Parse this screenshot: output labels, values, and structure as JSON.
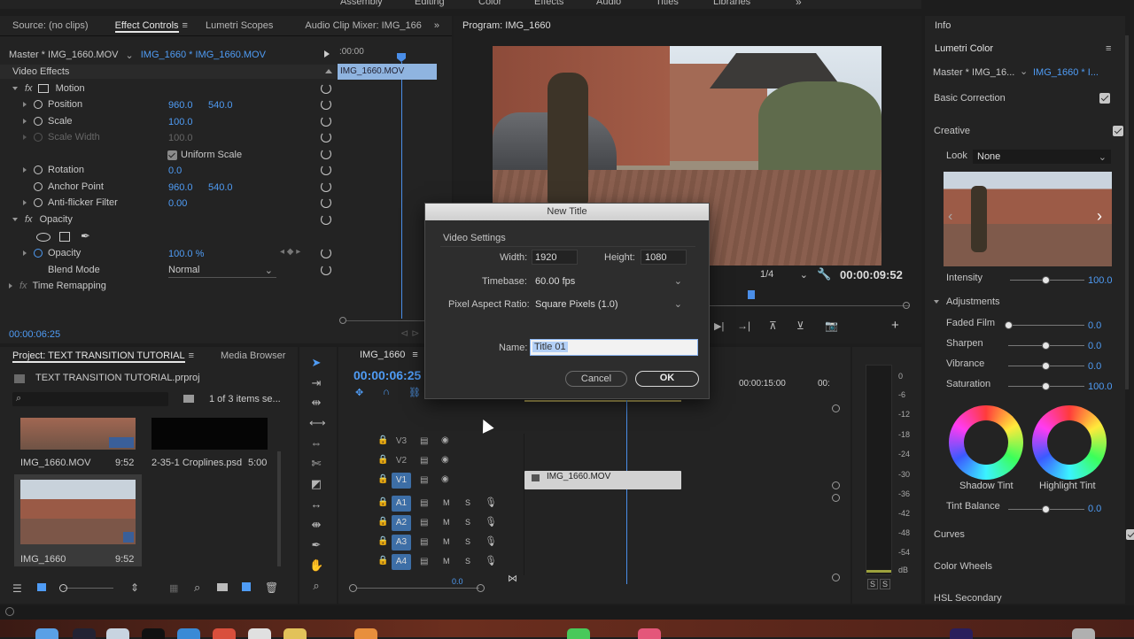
{
  "menu": {
    "items": [
      "Assembly",
      "Editing",
      "Color",
      "Effects",
      "Audio",
      "Titles",
      "Libraries"
    ],
    "more": "»"
  },
  "source_panel": {
    "tabs": [
      "Source: (no clips)",
      "Effect Controls",
      "Lumetri Scopes",
      "Audio Clip Mixer: IMG_166"
    ],
    "master_label": "Master * IMG_1660.MOV",
    "clip_label": "IMG_1660 * IMG_1660.MOV",
    "section": "Video Effects",
    "ruler_time": ":00:00",
    "clip_bar": "IMG_1660.MOV",
    "motion": "Motion",
    "position": {
      "label": "Position",
      "x": "960.0",
      "y": "540.0"
    },
    "scale": {
      "label": "Scale",
      "value": "100.0"
    },
    "scale_width": {
      "label": "Scale Width",
      "value": "100.0"
    },
    "uniform_scale": "Uniform Scale",
    "rotation": {
      "label": "Rotation",
      "value": "0.0"
    },
    "anchor": {
      "label": "Anchor Point",
      "x": "960.0",
      "y": "540.0"
    },
    "antiflicker": {
      "label": "Anti-flicker Filter",
      "value": "0.00"
    },
    "opacity_group": "Opacity",
    "opacity": {
      "label": "Opacity",
      "value": "100.0 %"
    },
    "blend": {
      "label": "Blend Mode",
      "value": "Normal"
    },
    "time_remap": "Time Remapping",
    "timecode": "00:00:06:25"
  },
  "program": {
    "title": "Program: IMG_1660",
    "fraction": "1/4",
    "timecode": "00:00:09:52"
  },
  "dialog": {
    "title": "New Title",
    "group": "Video Settings",
    "width_label": "Width:",
    "width_value": "1920",
    "height_label": "Height:",
    "height_value": "1080",
    "timebase_label": "Timebase:",
    "timebase_value": "60.00 fps",
    "par_label": "Pixel Aspect Ratio:",
    "par_value": "Square Pixels (1.0)",
    "name_label": "Name:",
    "name_value": "Title 01",
    "cancel": "Cancel",
    "ok": "OK"
  },
  "project": {
    "tabs": [
      "Project: TEXT TRANSITION TUTORIAL",
      "Media Browser"
    ],
    "more": "»",
    "file": "TEXT TRANSITION TUTORIAL.prproj",
    "count": "1 of 3 items se...",
    "items": [
      {
        "name": "IMG_1660.MOV",
        "dur": "9:52"
      },
      {
        "name": "2-35-1 Croplines.psd",
        "dur": "5:00"
      },
      {
        "name": "IMG_1660",
        "dur": "9:52"
      }
    ]
  },
  "timeline": {
    "tab": "IMG_1660",
    "timecode": "00:00:06:25",
    "ruler": [
      "00:00:15:00",
      "00:"
    ],
    "tracks_video": [
      "V3",
      "V2",
      "V1"
    ],
    "tracks_audio": [
      "A1",
      "A2",
      "A3",
      "A4"
    ],
    "m": "M",
    "s": "S",
    "clip": "IMG_1660.MOV",
    "zoom": "0.0"
  },
  "meter": {
    "scale": [
      "0",
      "-6",
      "-12",
      "-18",
      "-24",
      "-30",
      "-36",
      "-42",
      "-48",
      "-54",
      "dB"
    ],
    "solo": "S",
    "solo2": "S"
  },
  "lumetri": {
    "info": "Info",
    "title": "Lumetri Color",
    "master": "Master * IMG_16...",
    "clip": "IMG_1660 * I...",
    "basic": "Basic Correction",
    "creative": "Creative",
    "look_label": "Look",
    "look_value": "None",
    "intensity": {
      "label": "Intensity",
      "value": "100.0"
    },
    "adjustments": "Adjustments",
    "faded": {
      "label": "Faded Film",
      "value": "0.0"
    },
    "sharpen": {
      "label": "Sharpen",
      "value": "0.0"
    },
    "vibrance": {
      "label": "Vibrance",
      "value": "0.0"
    },
    "saturation": {
      "label": "Saturation",
      "value": "100.0"
    },
    "shadow_tint": "Shadow Tint",
    "highlight_tint": "Highlight Tint",
    "tint_balance": {
      "label": "Tint Balance",
      "value": "0.0"
    },
    "curves": "Curves",
    "wheels": "Color Wheels",
    "hsl": "HSL Secondary"
  }
}
